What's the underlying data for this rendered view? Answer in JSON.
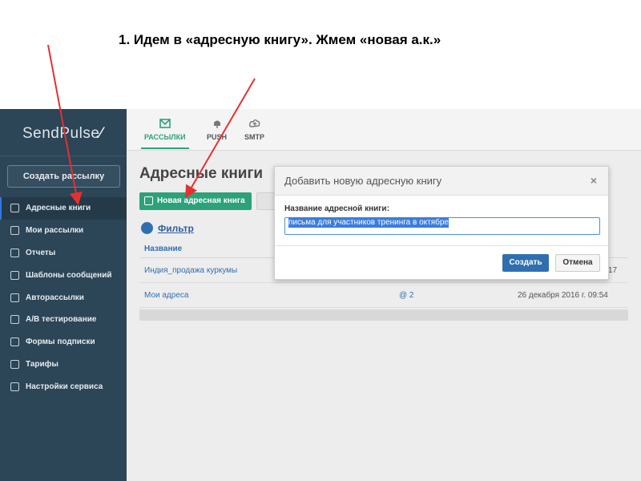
{
  "slide": {
    "title": "1. Идем в «адресную книгу». Жмем «новая а.к.»"
  },
  "sidebar": {
    "logo": "SendPulse",
    "create_button": "Создать рассылку",
    "items": [
      {
        "label": "Адресные книги",
        "icon": "address-book-icon",
        "active": true
      },
      {
        "label": "Мои рассылки",
        "icon": "mailings-icon"
      },
      {
        "label": "Отчеты",
        "icon": "reports-icon"
      },
      {
        "label": "Шаблоны сообщений",
        "icon": "templates-icon"
      },
      {
        "label": "Авторассылки",
        "icon": "autoresponder-icon"
      },
      {
        "label": "A/B тестирование",
        "icon": "ab-test-icon"
      },
      {
        "label": "Формы подписки",
        "icon": "forms-icon"
      },
      {
        "label": "Тарифы",
        "icon": "pricing-icon"
      },
      {
        "label": "Настройки сервиса",
        "icon": "settings-icon"
      }
    ]
  },
  "topbar": {
    "tabs": [
      {
        "label": "РАССЫЛКИ",
        "icon": "mail-icon",
        "active": true
      },
      {
        "label": "PUSH",
        "icon": "bell-icon"
      },
      {
        "label": "SMTP",
        "icon": "cloud-upload-icon"
      }
    ]
  },
  "main": {
    "page_title": "Адресные книги",
    "new_book_button": "Новая адресная книга",
    "filter_label": "Фильтр",
    "table": {
      "header": "Название",
      "rows": [
        {
          "name": "Индия_продажа куркумы",
          "count": "",
          "date": "",
          "date_tail": "17"
        },
        {
          "name": "Мои адреса",
          "count": "@ 2",
          "date": "26 декабря 2016 г. 09:54",
          "date_tail": ""
        }
      ]
    }
  },
  "modal": {
    "title": "Добавить новую адресную книгу",
    "close": "×",
    "field_label": "Название адресной книги:",
    "field_value": "письма для участников тренинга в октябре",
    "create_button": "Создать",
    "cancel_button": "Отмена"
  },
  "colors": {
    "sidebar": "#2c4557",
    "accent_green": "#2ba27a",
    "accent_blue": "#2f6fb0",
    "annotation_arrow": "#e53030"
  }
}
